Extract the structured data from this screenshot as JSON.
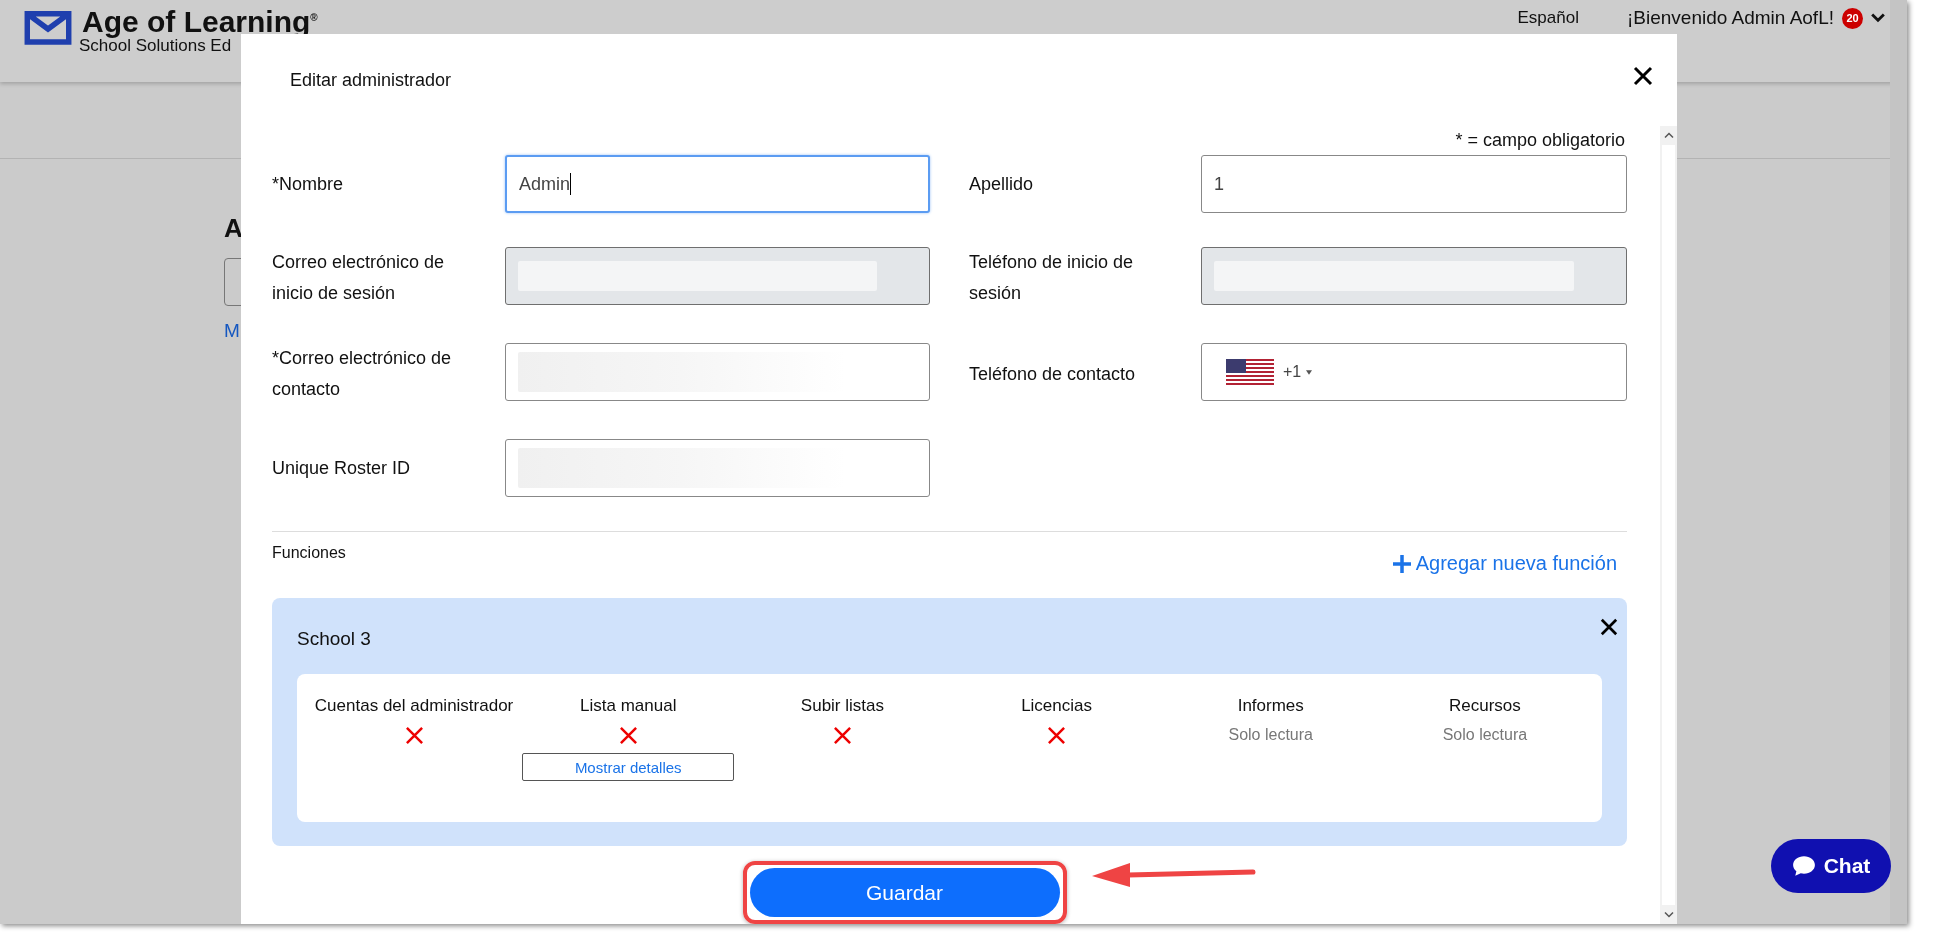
{
  "header": {
    "logo_title": "Age of Learning",
    "logo_mark": "®",
    "subtitle": "School Solutions Ed",
    "language": "Español",
    "welcome": "¡Bienvenido Admin AofL!",
    "notification_count": "20"
  },
  "background": {
    "heading": "A",
    "link": "M"
  },
  "modal": {
    "title": "Editar administrador",
    "required_note": "* = campo obligatorio",
    "fields": [
      {
        "label": "*Nombre",
        "kind": "text",
        "value": "Admin",
        "focused": true,
        "disabled": false
      },
      {
        "label": "Apellido",
        "kind": "text",
        "value": "1",
        "focused": false,
        "disabled": false
      },
      {
        "label": "Correo electrónico de inicio de sesión",
        "kind": "blurred",
        "focused": false,
        "disabled": true
      },
      {
        "label": "Teléfono de inicio de sesión",
        "kind": "blurred",
        "focused": false,
        "disabled": true
      },
      {
        "label": "*Correo electrónico de contacto",
        "kind": "blurred",
        "focused": false,
        "disabled": false
      },
      {
        "label": "Teléfono de contacto",
        "kind": "phone",
        "value": "+1",
        "focused": false,
        "disabled": false
      },
      {
        "label": "Unique Roster ID",
        "kind": "blurred",
        "focused": false,
        "disabled": false
      }
    ],
    "roles_title": "Funciones",
    "add_role": "Agregar nueva función",
    "role": {
      "school": "School 3",
      "permissions": [
        {
          "name": "Cuentas del administrador",
          "kind": "denied"
        },
        {
          "name": "Lista manual",
          "kind": "denied",
          "details_button": "Mostrar detalles"
        },
        {
          "name": "Subir listas",
          "kind": "denied"
        },
        {
          "name": "Licencias",
          "kind": "denied"
        },
        {
          "name": "Informes",
          "kind": "text",
          "value": "Solo lectura"
        },
        {
          "name": "Recursos",
          "kind": "text",
          "value": "Solo lectura"
        }
      ]
    },
    "save_button": "Guardar"
  },
  "chat_button": "Chat"
}
